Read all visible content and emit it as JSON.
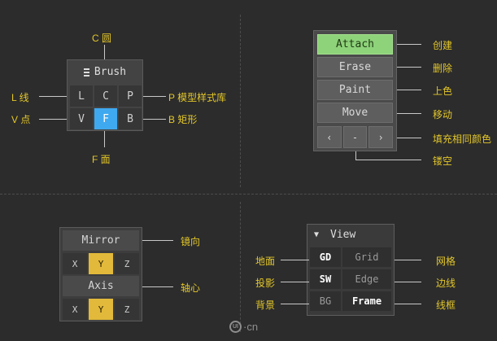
{
  "brush": {
    "icon": "menu-icon",
    "title": "Brush",
    "cells": [
      {
        "label": "L",
        "active": false
      },
      {
        "label": "C",
        "active": false
      },
      {
        "label": "P",
        "active": false
      },
      {
        "label": "V",
        "active": false
      },
      {
        "label": "F",
        "active": true
      },
      {
        "label": "B",
        "active": false
      }
    ],
    "annotations": {
      "top": "C 圆",
      "left_l": "L 线",
      "left_v": "V 点",
      "right_p": "P 模型样式库",
      "right_b": "B 矩形",
      "bottom": "F 面"
    }
  },
  "tools": {
    "buttons": [
      {
        "label": "Attach",
        "note": "创建",
        "active": true
      },
      {
        "label": "Erase",
        "note": "删除",
        "active": false
      },
      {
        "label": "Paint",
        "note": "上色",
        "active": false
      },
      {
        "label": "Move",
        "note": "移动",
        "active": false
      }
    ],
    "nav": {
      "prev": "‹",
      "mid": "-",
      "next": "›"
    },
    "nav_note": "填充相同颜色",
    "mid_note": "镂空"
  },
  "mirror": {
    "title": "Mirror",
    "title_note": "镜向",
    "axes": [
      "X",
      "Y",
      "Z"
    ],
    "active_axis": "Y",
    "axis_title": "Axis",
    "axis_note": "轴心"
  },
  "view": {
    "arrow": "▼",
    "title": "View",
    "rows": [
      {
        "left": "GD",
        "left_on": true,
        "left_note": "地面",
        "right": "Grid",
        "right_on": false,
        "right_note": "网格"
      },
      {
        "left": "SW",
        "left_on": true,
        "left_note": "投影",
        "right": "Edge",
        "right_on": false,
        "right_note": "边线"
      },
      {
        "left": "BG",
        "left_on": false,
        "left_note": "背景",
        "right": "Frame",
        "right_on": true,
        "right_note": "线框"
      }
    ]
  },
  "watermark": {
    "logo": "UI",
    "text": "·cn"
  },
  "colors": {
    "background": "#2c2c2c",
    "annotation": "#e2c62a",
    "brush_active": "#3fa9f0",
    "attach_active": "#8ed27a",
    "axis_active": "#e2b93a"
  }
}
